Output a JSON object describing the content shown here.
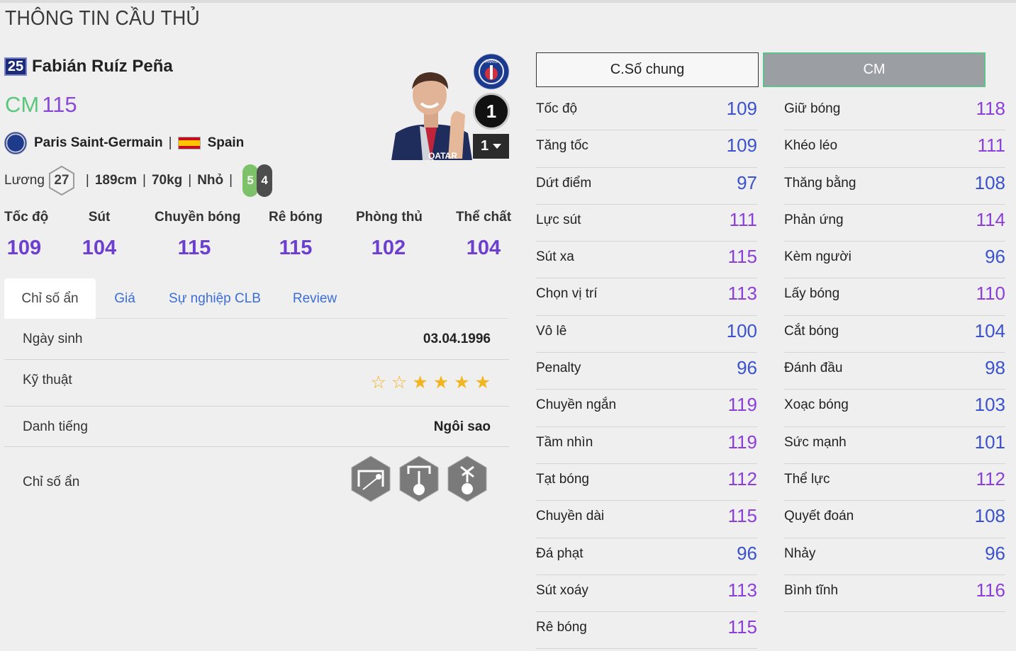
{
  "page_title": "THÔNG TIN CẦU THỦ",
  "player": {
    "season_badge": "25",
    "name": "Fabián Ruíz Peña",
    "position": "CM",
    "ovr": "115",
    "club": "Paris Saint-Germain",
    "nation": "Spain",
    "salary_label": "Lương",
    "salary": "27",
    "height": "189cm",
    "weight": "70kg",
    "body_type": "Nhỏ",
    "left_foot": "5",
    "right_foot": "4",
    "rank": "1",
    "enhance_level": "1"
  },
  "summary": [
    {
      "label": "Tốc độ",
      "value": "109"
    },
    {
      "label": "Sút",
      "value": "104"
    },
    {
      "label": "Chuyền bóng",
      "value": "115"
    },
    {
      "label": "Rê bóng",
      "value": "115"
    },
    {
      "label": "Phòng thủ",
      "value": "102"
    },
    {
      "label": "Thể chất",
      "value": "104"
    }
  ],
  "tabs": [
    {
      "label": "Chỉ số ẩn",
      "active": true
    },
    {
      "label": "Giá",
      "active": false
    },
    {
      "label": "Sự nghiệp CLB",
      "active": false
    },
    {
      "label": "Review",
      "active": false
    }
  ],
  "info": {
    "birth_label": "Ngày sinh",
    "birth_value": "03.04.1996",
    "skill_label": "Kỹ thuật",
    "skill_stars": 4,
    "skill_stars_max": 6,
    "reputation_label": "Danh tiếng",
    "reputation_value": "Ngôi sao",
    "traits_label": "Chỉ số ẩn",
    "trait_icons": [
      "long-shot-taker-icon",
      "power-header-icon",
      "flair-icon"
    ]
  },
  "right_tabs": {
    "general": "C.Số chung",
    "position": "CM"
  },
  "attributes_left": [
    {
      "name": "Tốc độ",
      "value": "109",
      "color": "blue"
    },
    {
      "name": "Tăng tốc",
      "value": "109",
      "color": "blue"
    },
    {
      "name": "Dứt điểm",
      "value": "97",
      "color": "blue"
    },
    {
      "name": "Lực sút",
      "value": "111",
      "color": "purple"
    },
    {
      "name": "Sút xa",
      "value": "115",
      "color": "purple"
    },
    {
      "name": "Chọn vị trí",
      "value": "113",
      "color": "purple"
    },
    {
      "name": "Vô lê",
      "value": "100",
      "color": "blue"
    },
    {
      "name": "Penalty",
      "value": "96",
      "color": "blue"
    },
    {
      "name": "Chuyền ngắn",
      "value": "119",
      "color": "purple"
    },
    {
      "name": "Tầm nhìn",
      "value": "119",
      "color": "purple"
    },
    {
      "name": "Tạt bóng",
      "value": "112",
      "color": "purple"
    },
    {
      "name": "Chuyền dài",
      "value": "115",
      "color": "purple"
    },
    {
      "name": "Đá phạt",
      "value": "96",
      "color": "blue"
    },
    {
      "name": "Sút xoáy",
      "value": "113",
      "color": "purple"
    },
    {
      "name": "Rê bóng",
      "value": "115",
      "color": "purple"
    }
  ],
  "attributes_right": [
    {
      "name": "Giữ bóng",
      "value": "118",
      "color": "purple"
    },
    {
      "name": "Khéo léo",
      "value": "111",
      "color": "purple"
    },
    {
      "name": "Thăng bằng",
      "value": "108",
      "color": "blue"
    },
    {
      "name": "Phản ứng",
      "value": "114",
      "color": "purple"
    },
    {
      "name": "Kèm người",
      "value": "96",
      "color": "blue"
    },
    {
      "name": "Lấy bóng",
      "value": "110",
      "color": "purple"
    },
    {
      "name": "Cắt bóng",
      "value": "104",
      "color": "blue"
    },
    {
      "name": "Đánh đầu",
      "value": "98",
      "color": "blue"
    },
    {
      "name": "Xoạc bóng",
      "value": "103",
      "color": "blue"
    },
    {
      "name": "Sức mạnh",
      "value": "101",
      "color": "blue"
    },
    {
      "name": "Thể lực",
      "value": "112",
      "color": "purple"
    },
    {
      "name": "Quyết đoán",
      "value": "108",
      "color": "blue"
    },
    {
      "name": "Nhảy",
      "value": "96",
      "color": "blue"
    },
    {
      "name": "Bình tĩnh",
      "value": "116",
      "color": "purple"
    }
  ]
}
